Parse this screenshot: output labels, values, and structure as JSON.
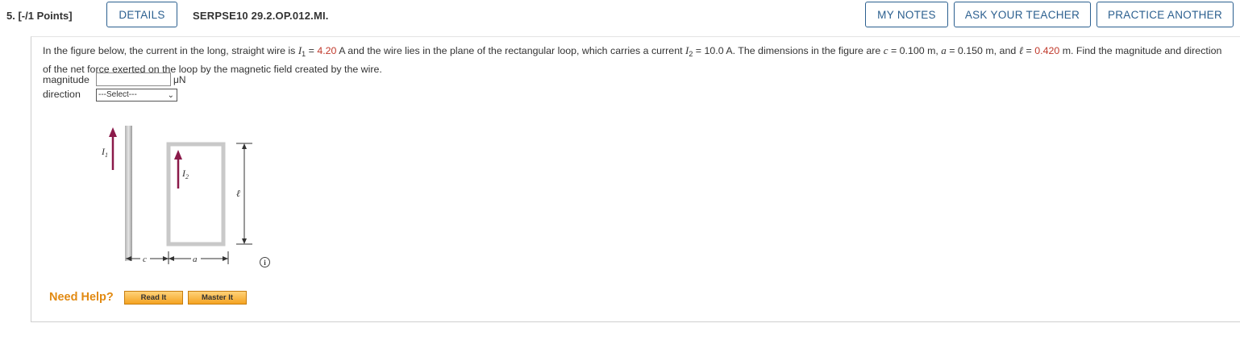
{
  "header": {
    "question_number": "5. [-/1 Points]",
    "details_label": "DETAILS",
    "problem_code": "SERPSE10 29.2.OP.012.MI.",
    "my_notes_label": "MY NOTES",
    "ask_teacher_label": "ASK YOUR TEACHER",
    "practice_another_label": "PRACTICE ANOTHER"
  },
  "question": {
    "part1": "In the figure below, the current in the long, straight wire is ",
    "i1_symbol": "I",
    "i1_sub": "1",
    "eq1": " = ",
    "i1_value": "4.20",
    "part2": " A and the wire lies in the plane of the rectangular loop, which carries a current ",
    "i2_symbol": "I",
    "i2_sub": "2",
    "part3": " = 10.0 A. The dimensions in the figure are ",
    "c_sym": "c",
    "part4": " = 0.100 m, ",
    "a_sym": "a",
    "part5": " = 0.150 m, and ",
    "l_sym": "ℓ",
    "eq2": " = ",
    "l_value": "0.420",
    "part6": " m. Find the magnitude and direction of the net force exerted on the loop by the magnetic field created by the wire."
  },
  "answers": {
    "magnitude_label": "magnitude",
    "magnitude_value": "",
    "magnitude_unit": "μN",
    "direction_label": "direction",
    "direction_selected": "---Select---"
  },
  "figure": {
    "label_i1": "I",
    "label_i1_sub": "1",
    "label_i2": "I",
    "label_i2_sub": "2",
    "label_l": "ℓ",
    "label_c": "c",
    "label_a": "a",
    "arrow_color": "#8b1a4a",
    "loop_color": "#c9c9c9",
    "info_glyph": "i"
  },
  "help": {
    "label": "Need Help?",
    "read_it": "Read It",
    "master_it": "Master It"
  }
}
